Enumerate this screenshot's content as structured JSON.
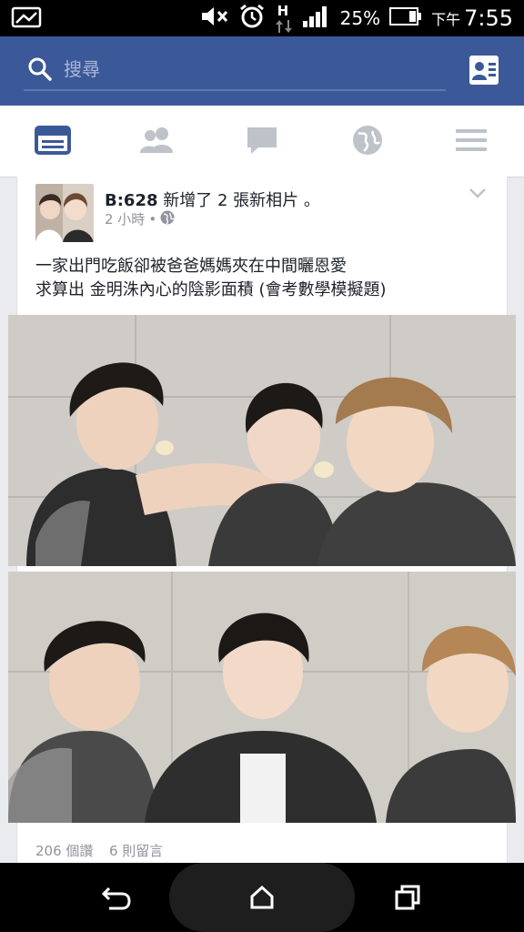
{
  "status_bar": {
    "battery_percent": "25%",
    "ampm": "下午",
    "time": "7:55",
    "network": "H"
  },
  "search": {
    "placeholder": "搜尋"
  },
  "nav": {
    "items": [
      "news-feed",
      "friends",
      "messages",
      "notifications",
      "menu"
    ],
    "active": "news-feed"
  },
  "post": {
    "author": "B:628",
    "action": "新增了 2 張新相片 。",
    "time": "2 小時",
    "separator": "•",
    "text_line1": "一家出門吃飯卻被爸爸媽媽夾在中間曬恩愛",
    "text_line2": "求算出 金明洙內心的陰影面積 (會考數學模擬題)",
    "likes": "206 個讚",
    "comments": "6 則留言"
  },
  "colors": {
    "facebook_blue": "#3b5998",
    "nav_icon_active": "#3b5998",
    "nav_icon_inactive": "#bec2c9"
  }
}
